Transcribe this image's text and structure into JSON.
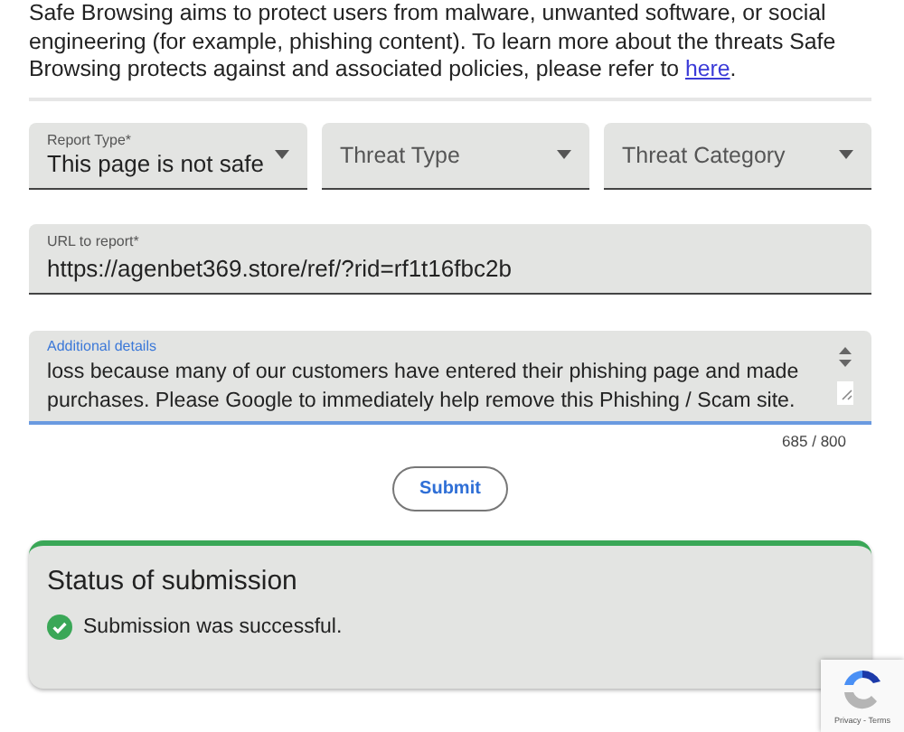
{
  "intro": {
    "text": "Safe Browsing aims to protect users from malware, unwanted software, or social engineering (for example, phishing content). To learn more about the threats Safe Browsing protects against and associated policies, please refer to",
    "link": "here",
    "end": "."
  },
  "dropdowns": [
    {
      "label": "Report Type*",
      "value": "This page is not safe"
    },
    {
      "placeholder": "Threat Type"
    },
    {
      "placeholder": "Threat Category"
    }
  ],
  "url_field": {
    "label": "URL to report*",
    "value": "https://agenbet369.store/ref/?rid=rf1t16fbc2b"
  },
  "details_field": {
    "label": "Additional details",
    "value": "loss because many of our customers have entered their phishing page and made purchases. Please Google to immediately help remove this Phishing / Scam site.",
    "focused": true,
    "counter": "685 / 800"
  },
  "submit": "Submit",
  "status": {
    "title": "Status of submission",
    "message": "Submission was successful.",
    "kind": "success"
  },
  "recaptcha": {
    "links": "Privacy - Terms"
  }
}
